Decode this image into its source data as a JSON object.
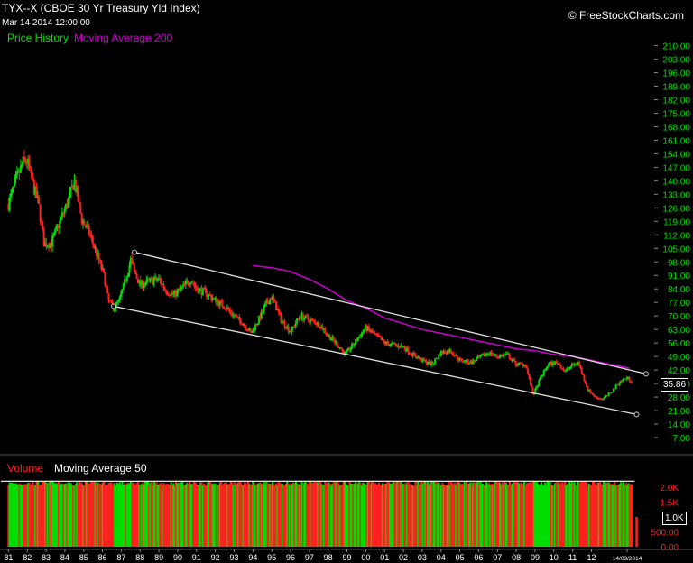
{
  "header": {
    "title": "TYX--X (CBOE 30 Yr Treasury Yld Index)",
    "datetime": "Mar 14 2014 12:00:00",
    "watermark": "© FreeStockCharts.com"
  },
  "legend": {
    "price_label": "Price History",
    "price_color": "#00dd00",
    "ma_label": "Moving Average 200",
    "ma_color": "#cc00cc"
  },
  "volume_legend": {
    "volume_label": "Volume",
    "volume_color": "#ff2020",
    "ma_label": "Moving Average 50",
    "ma_color": "#ffffff"
  },
  "badges": {
    "last_price": "35.86",
    "last_volume": "1.0K"
  },
  "chart_data": [
    {
      "type": "candlestick",
      "title": "TYX--X (CBOE 30 Yr Treasury Yld Index)",
      "up_color": "#00dd00",
      "down_color": "#ff2020",
      "x_ticks": [
        "81",
        "82",
        "83",
        "84",
        "85",
        "86",
        "87",
        "88",
        "89",
        "90",
        "91",
        "92",
        "93",
        "94",
        "95",
        "96",
        "97",
        "98",
        "99",
        "00",
        "01",
        "02",
        "03",
        "04",
        "05",
        "06",
        "07",
        "08",
        "09",
        "10",
        "11",
        "12",
        "14/03/2014"
      ],
      "y_ticks": [
        "210.00",
        "203.00",
        "196.00",
        "189.00",
        "182.00",
        "175.00",
        "168.00",
        "161.00",
        "154.00",
        "147.00",
        "140.00",
        "133.00",
        "126.00",
        "119.00",
        "112.00",
        "105.00",
        "98.00",
        "91.00",
        "84.00",
        "77.00",
        "70.00",
        "63.00",
        "56.00",
        "49.00",
        "42.00",
        "35.00",
        "28.00",
        "21.00",
        "14.00",
        "7.00"
      ],
      "ylim": [
        0,
        214
      ],
      "price_series": [
        [
          1981.0,
          128
        ],
        [
          1981.4,
          140
        ],
        [
          1981.8,
          150
        ],
        [
          1982.0,
          150
        ],
        [
          1982.3,
          138
        ],
        [
          1982.6,
          128
        ],
        [
          1982.9,
          107
        ],
        [
          1983.3,
          108
        ],
        [
          1983.7,
          118
        ],
        [
          1984.2,
          130
        ],
        [
          1984.5,
          140
        ],
        [
          1984.9,
          120
        ],
        [
          1985.3,
          113
        ],
        [
          1985.7,
          102
        ],
        [
          1986.1,
          90
        ],
        [
          1986.3,
          78
        ],
        [
          1986.6,
          74
        ],
        [
          1986.9,
          78
        ],
        [
          1987.2,
          88
        ],
        [
          1987.5,
          99
        ],
        [
          1987.7,
          93
        ],
        [
          1988.0,
          86
        ],
        [
          1988.5,
          88
        ],
        [
          1989.0,
          89
        ],
        [
          1989.4,
          83
        ],
        [
          1989.8,
          81
        ],
        [
          1990.3,
          85
        ],
        [
          1990.7,
          89
        ],
        [
          1991.0,
          84
        ],
        [
          1991.5,
          82
        ],
        [
          1992.0,
          78
        ],
        [
          1992.5,
          75
        ],
        [
          1993.0,
          70
        ],
        [
          1993.5,
          66
        ],
        [
          1993.9,
          61
        ],
        [
          1994.3,
          68
        ],
        [
          1994.7,
          76
        ],
        [
          1995.0,
          80
        ],
        [
          1995.5,
          68
        ],
        [
          1996.0,
          62
        ],
        [
          1996.5,
          70
        ],
        [
          1997.0,
          68
        ],
        [
          1997.5,
          66
        ],
        [
          1998.0,
          60
        ],
        [
          1998.6,
          54
        ],
        [
          1998.9,
          50
        ],
        [
          1999.4,
          56
        ],
        [
          2000.0,
          64
        ],
        [
          2000.5,
          60
        ],
        [
          2001.0,
          56
        ],
        [
          2001.5,
          55
        ],
        [
          2002.0,
          54
        ],
        [
          2002.5,
          50
        ],
        [
          2003.0,
          47
        ],
        [
          2003.5,
          45
        ],
        [
          2004.0,
          51
        ],
        [
          2004.5,
          52
        ],
        [
          2005.0,
          47
        ],
        [
          2005.6,
          46
        ],
        [
          2006.0,
          48
        ],
        [
          2006.5,
          51
        ],
        [
          2007.0,
          49
        ],
        [
          2007.5,
          50
        ],
        [
          2008.0,
          45
        ],
        [
          2008.5,
          45
        ],
        [
          2008.9,
          29
        ],
        [
          2009.3,
          38
        ],
        [
          2009.7,
          45
        ],
        [
          2010.2,
          46
        ],
        [
          2010.6,
          41
        ],
        [
          2010.9,
          44
        ],
        [
          2011.3,
          46
        ],
        [
          2011.8,
          32
        ],
        [
          2012.2,
          28
        ],
        [
          2012.6,
          27
        ],
        [
          2013.0,
          30
        ],
        [
          2013.5,
          36
        ],
        [
          2013.9,
          38
        ],
        [
          2014.2,
          35.86
        ]
      ],
      "moving_average_200": [
        [
          1994.0,
          96
        ],
        [
          1995.0,
          95
        ],
        [
          1996.0,
          93
        ],
        [
          1997.0,
          89
        ],
        [
          1998.0,
          84
        ],
        [
          1999.0,
          78
        ],
        [
          2000.0,
          74
        ],
        [
          2001.0,
          69
        ],
        [
          2002.0,
          66
        ],
        [
          2003.0,
          63
        ],
        [
          2004.0,
          61
        ],
        [
          2005.0,
          59
        ],
        [
          2006.0,
          57
        ],
        [
          2007.0,
          55
        ],
        [
          2008.0,
          53
        ],
        [
          2009.0,
          52
        ],
        [
          2010.0,
          50
        ],
        [
          2011.0,
          49
        ],
        [
          2012.0,
          47
        ],
        [
          2013.0,
          45
        ],
        [
          2014.0,
          43
        ]
      ],
      "trend_lines": [
        {
          "from": [
            1987.7,
            103
          ],
          "to": [
            2014.9,
            40
          ]
        },
        {
          "from": [
            1986.6,
            75
          ],
          "to": [
            2014.4,
            19
          ]
        }
      ]
    },
    {
      "type": "bar",
      "title": "Volume",
      "y_ticks": [
        "2.0K",
        "1.5K",
        "1.0K",
        "500.00",
        "0.00"
      ],
      "ylim": [
        0,
        2300
      ],
      "typical_volume": 2200,
      "last_volume": 1000,
      "moving_average_50": 2200
    }
  ]
}
